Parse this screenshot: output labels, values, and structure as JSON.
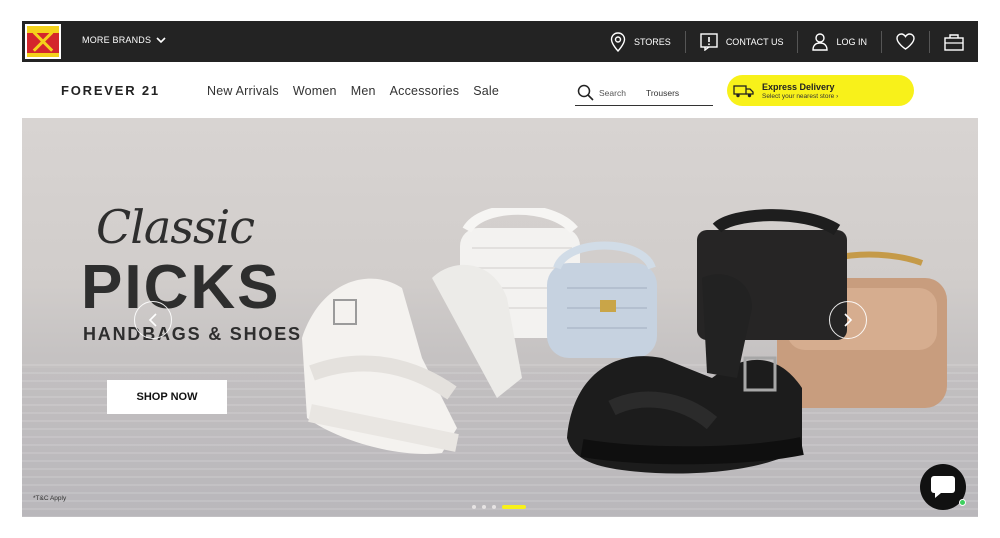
{
  "topbar": {
    "more_brands": "MORE BRANDS",
    "stores": "STORES",
    "contact_us": "CONTACT US",
    "log_in": "LOG IN"
  },
  "nav": {
    "logo": "FOREVER 21",
    "menu": [
      "New Arrivals",
      "Women",
      "Men",
      "Accessories",
      "Sale"
    ],
    "search_label": "Search",
    "search_value": "Trousers",
    "express_title": "Express Delivery",
    "express_sub": "Select your nearest store ›"
  },
  "hero": {
    "script_title": "Classic",
    "main_title": "PICKS",
    "subtitle": "HANDBAGS & SHOES",
    "cta": "SHOP NOW",
    "tnc": "*T&C Apply",
    "slides": 3,
    "active_slide": 3
  },
  "colors": {
    "topbar_bg": "#232323",
    "accent_yellow": "#f8f11a"
  }
}
